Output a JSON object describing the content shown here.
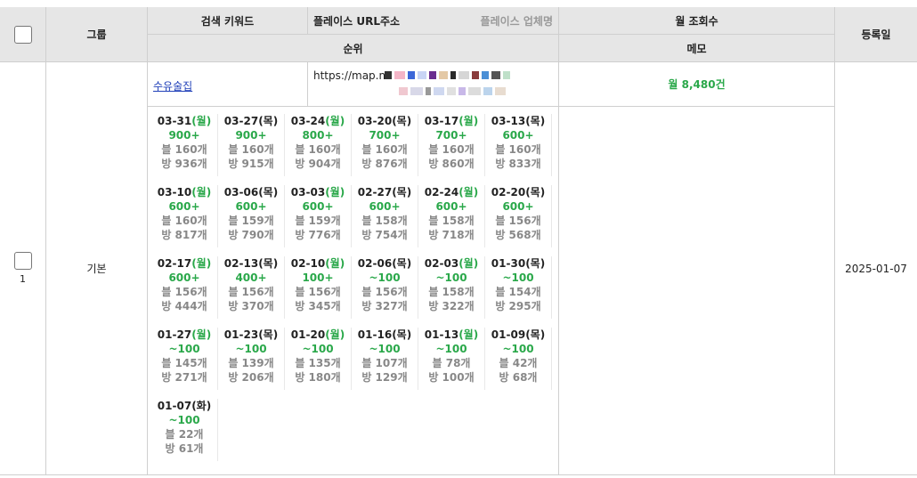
{
  "header": {
    "group": "그룹",
    "keyword": "검색 키워드",
    "place_url": "플레이스 URL주소",
    "place_name": "플레이스 업체명",
    "monthly_views": "월 조회수",
    "rank": "순위",
    "memo": "메모",
    "reg_date": "등록일"
  },
  "row": {
    "index": "1",
    "group": "기본",
    "keyword": "수유술집",
    "url_prefix": "https://map.na",
    "monthly_views": "월 8,480건",
    "reg_date": "2025-01-07"
  },
  "colors": {
    "header_bg": "#e6e6e6",
    "green": "#2aa84a",
    "link": "#1f3fb8",
    "muted": "#888888"
  },
  "ranks": [
    {
      "date": "03-31",
      "dow": "(월)",
      "green_dow": true,
      "rank": "900+",
      "blog": "블 160개",
      "place": "방 936개"
    },
    {
      "date": "03-27",
      "dow": "(목)",
      "green_dow": false,
      "rank": "900+",
      "blog": "블 160개",
      "place": "방 915개"
    },
    {
      "date": "03-24",
      "dow": "(월)",
      "green_dow": true,
      "rank": "800+",
      "blog": "블 160개",
      "place": "방 904개"
    },
    {
      "date": "03-20",
      "dow": "(목)",
      "green_dow": false,
      "rank": "700+",
      "blog": "블 160개",
      "place": "방 876개"
    },
    {
      "date": "03-17",
      "dow": "(월)",
      "green_dow": true,
      "rank": "700+",
      "blog": "블 160개",
      "place": "방 860개"
    },
    {
      "date": "03-13",
      "dow": "(목)",
      "green_dow": false,
      "rank": "600+",
      "blog": "블 160개",
      "place": "방 833개"
    },
    {
      "date": "03-10",
      "dow": "(월)",
      "green_dow": true,
      "rank": "600+",
      "blog": "블 160개",
      "place": "방 817개"
    },
    {
      "date": "03-06",
      "dow": "(목)",
      "green_dow": false,
      "rank": "600+",
      "blog": "블 159개",
      "place": "방 790개"
    },
    {
      "date": "03-03",
      "dow": "(월)",
      "green_dow": true,
      "rank": "600+",
      "blog": "블 159개",
      "place": "방 776개"
    },
    {
      "date": "02-27",
      "dow": "(목)",
      "green_dow": false,
      "rank": "600+",
      "blog": "블 158개",
      "place": "방 754개"
    },
    {
      "date": "02-24",
      "dow": "(월)",
      "green_dow": true,
      "rank": "600+",
      "blog": "블 158개",
      "place": "방 718개"
    },
    {
      "date": "02-20",
      "dow": "(목)",
      "green_dow": false,
      "rank": "600+",
      "blog": "블 156개",
      "place": "방 568개"
    },
    {
      "date": "02-17",
      "dow": "(월)",
      "green_dow": true,
      "rank": "600+",
      "blog": "블 156개",
      "place": "방 444개"
    },
    {
      "date": "02-13",
      "dow": "(목)",
      "green_dow": false,
      "rank": "400+",
      "blog": "블 156개",
      "place": "방 370개"
    },
    {
      "date": "02-10",
      "dow": "(월)",
      "green_dow": true,
      "rank": "100+",
      "blog": "블 156개",
      "place": "방 345개"
    },
    {
      "date": "02-06",
      "dow": "(목)",
      "green_dow": false,
      "rank": "~100",
      "blog": "블 156개",
      "place": "방 327개"
    },
    {
      "date": "02-03",
      "dow": "(월)",
      "green_dow": true,
      "rank": "~100",
      "blog": "블 158개",
      "place": "방 322개"
    },
    {
      "date": "01-30",
      "dow": "(목)",
      "green_dow": false,
      "rank": "~100",
      "blog": "블 154개",
      "place": "방 295개"
    },
    {
      "date": "01-27",
      "dow": "(월)",
      "green_dow": true,
      "rank": "~100",
      "blog": "블 145개",
      "place": "방 271개"
    },
    {
      "date": "01-23",
      "dow": "(목)",
      "green_dow": false,
      "rank": "~100",
      "blog": "블 139개",
      "place": "방 206개"
    },
    {
      "date": "01-20",
      "dow": "(월)",
      "green_dow": true,
      "rank": "~100",
      "blog": "블 135개",
      "place": "방 180개"
    },
    {
      "date": "01-16",
      "dow": "(목)",
      "green_dow": false,
      "rank": "~100",
      "blog": "블 107개",
      "place": "방 129개"
    },
    {
      "date": "01-13",
      "dow": "(월)",
      "green_dow": true,
      "rank": "~100",
      "blog": "블 78개",
      "place": "방 100개"
    },
    {
      "date": "01-09",
      "dow": "(목)",
      "green_dow": false,
      "rank": "~100",
      "blog": "블 42개",
      "place": "방 68개"
    },
    {
      "date": "01-07",
      "dow": "(화)",
      "green_dow": false,
      "rank": "~100",
      "blog": "블 22개",
      "place": "방 61개"
    }
  ]
}
